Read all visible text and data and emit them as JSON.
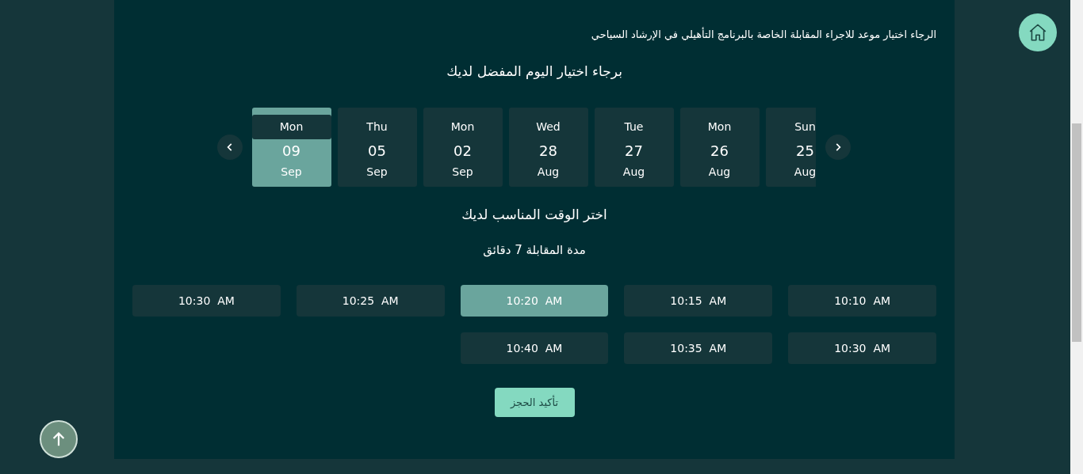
{
  "subtitle": "الرجاء اختيار موعد للاجراء المقابلة الخاصة بالبرنامج التأهيلي في الإرشاد السياحي",
  "day_heading": "برجاء اختيار اليوم المفضل لديك",
  "days": [
    {
      "weekday": "Mon",
      "day": "09",
      "month": "Sep",
      "selected": true
    },
    {
      "weekday": "Thu",
      "day": "05",
      "month": "Sep",
      "selected": false
    },
    {
      "weekday": "Mon",
      "day": "02",
      "month": "Sep",
      "selected": false
    },
    {
      "weekday": "Wed",
      "day": "28",
      "month": "Aug",
      "selected": false
    },
    {
      "weekday": "Tue",
      "day": "27",
      "month": "Aug",
      "selected": false
    },
    {
      "weekday": "Mon",
      "day": "26",
      "month": "Aug",
      "selected": false
    },
    {
      "weekday": "Sun",
      "day": "25",
      "month": "Aug",
      "selected": false
    }
  ],
  "time_heading": "اختر الوقت المناسب لديك",
  "duration": "مدة المقابلة 7 دقائق",
  "slots": [
    {
      "time": "10:30  AM",
      "selected": false
    },
    {
      "time": "10:25  AM",
      "selected": false
    },
    {
      "time": "10:20  AM",
      "selected": true
    },
    {
      "time": "10:15  AM",
      "selected": false
    },
    {
      "time": "10:10  AM",
      "selected": false
    },
    {
      "time": "10:40  AM",
      "selected": false
    },
    {
      "time": "10:35  AM",
      "selected": false
    },
    {
      "time": "10:30  AM",
      "selected": false
    }
  ],
  "confirm_button": "تأكيد الحجز"
}
